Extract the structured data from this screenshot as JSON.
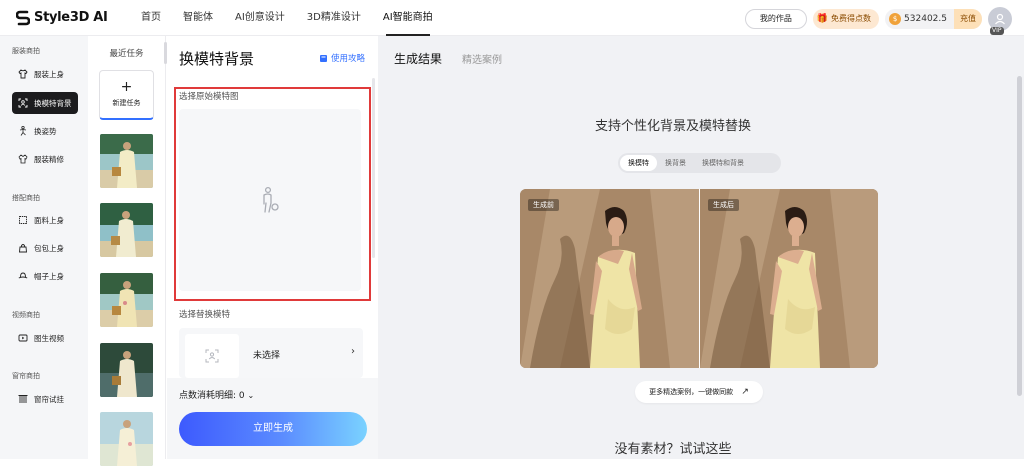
{
  "app": {
    "logo_text": "Style3D AI"
  },
  "nav": {
    "items": [
      "首页",
      "智能体",
      "AI创意设计",
      "3D精准设计",
      "AI智能商拍"
    ],
    "active_index": 4
  },
  "top_right": {
    "my_works": "我的作品",
    "free_points": "免费得点数",
    "points": "532402.5",
    "recharge": "充值",
    "vip": "VIP"
  },
  "sidebar": {
    "groups": [
      {
        "title": "服装商拍",
        "items": [
          "服装上身",
          "换模特背景",
          "换姿势",
          "服装精修"
        ]
      },
      {
        "title": "搭配商拍",
        "items": [
          "面料上身",
          "包包上身",
          "帽子上身"
        ]
      },
      {
        "title": "视频商拍",
        "items": [
          "图生视频"
        ]
      },
      {
        "title": "窗帘商拍",
        "items": [
          "窗帘试挂"
        ]
      }
    ],
    "active": "换模特背景"
  },
  "tasks": {
    "title": "最近任务",
    "new_task": "新建任务"
  },
  "panel": {
    "title": "换模特背景",
    "guide": "使用攻略",
    "upload_label": "选择原始模特图",
    "model_label": "选择替换模特",
    "model_value": "未选择",
    "cost_label": "点数消耗明细: 0",
    "generate": "立即生成"
  },
  "main": {
    "tabs": [
      "生成结果",
      "精选案例"
    ],
    "heading": "支持个性化背景及模特替换",
    "segments": [
      "换模特",
      "换背景",
      "换模特和背景"
    ],
    "active_segment": 0,
    "before_tag": "生成前",
    "after_tag": "生成后",
    "more_cases": "更多精选案例，一键做同款",
    "bottom_heading": "没有素材？试试这些"
  },
  "colors": {
    "accent": "#3370ff",
    "highlight_frame": "#e03a3a",
    "sidebar_active": "#1c1c1e"
  }
}
